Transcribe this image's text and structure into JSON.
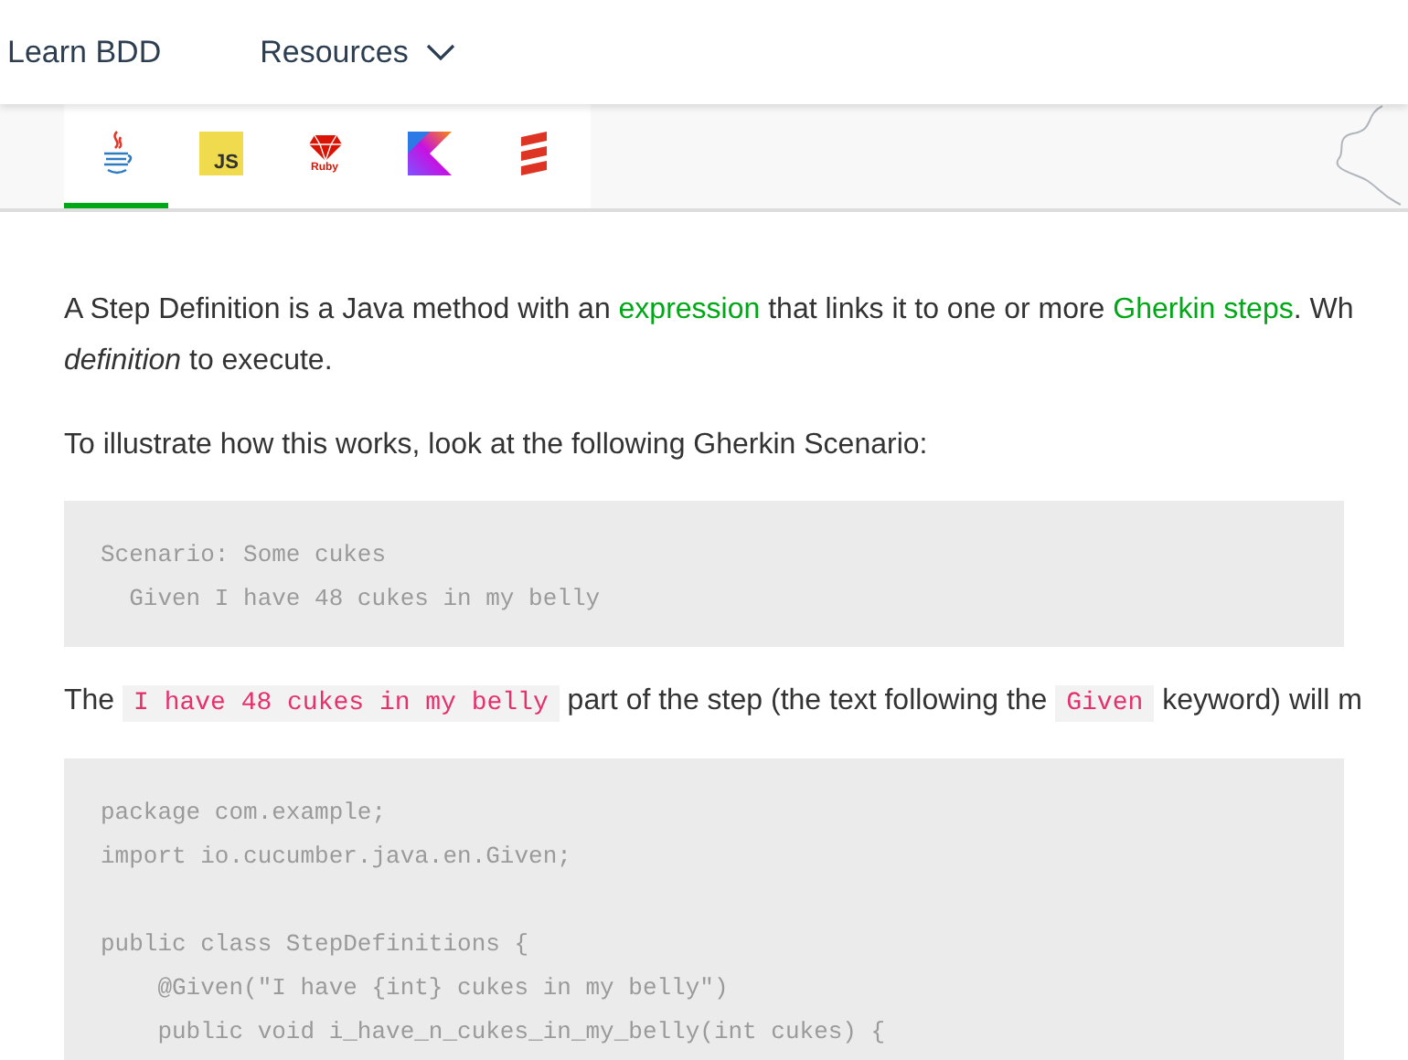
{
  "nav": {
    "items": [
      {
        "label": "Learn BDD",
        "kind": "link"
      },
      {
        "label": "Resources",
        "kind": "dropdown"
      }
    ]
  },
  "language_tabs": [
    {
      "kind": "java",
      "selected": true
    },
    {
      "kind": "javascript",
      "label": "JS",
      "selected": false
    },
    {
      "kind": "ruby",
      "label": "Ruby",
      "selected": false
    },
    {
      "kind": "kotlin",
      "selected": false
    },
    {
      "kind": "scala",
      "selected": false
    }
  ],
  "content": [
    {
      "kind": "paragraph",
      "segments": [
        {
          "kind": "text",
          "text": "A Step Definition is a Java method with an "
        },
        {
          "kind": "link",
          "text": "expression"
        },
        {
          "kind": "text",
          "text": " that links it to one or more "
        },
        {
          "kind": "link",
          "text": "Gherkin steps"
        },
        {
          "kind": "text",
          "text": ". Wh"
        },
        {
          "kind": "break"
        },
        {
          "kind": "text",
          "text": "*definition* to execute."
        }
      ]
    },
    {
      "kind": "paragraph",
      "segments": [
        {
          "kind": "text",
          "text": "To illustrate how this works, look at the following Gherkin Scenario:"
        }
      ]
    },
    {
      "kind": "code",
      "groups": [
        [
          "Scenario: Some cukes",
          "  Given I have 48 cukes in my belly"
        ]
      ]
    },
    {
      "kind": "paragraph",
      "segments": [
        {
          "kind": "text",
          "text": "The "
        },
        {
          "kind": "code",
          "text": "I have 48 cukes in my belly"
        },
        {
          "kind": "text",
          "text": " part of the step (the text following the "
        },
        {
          "kind": "code",
          "text": "Given"
        },
        {
          "kind": "text",
          "text": " keyword) will m"
        }
      ]
    },
    {
      "kind": "code",
      "groups": [
        [
          "package com.example;",
          "import io.cucumber.java.en.Given;"
        ],
        [
          "public class StepDefinitions {",
          "    @Given(\"I have {int} cukes in my belly\")",
          "    public void i_have_n_cukes_in_my_belly(int cukes) {"
        ]
      ]
    }
  ]
}
